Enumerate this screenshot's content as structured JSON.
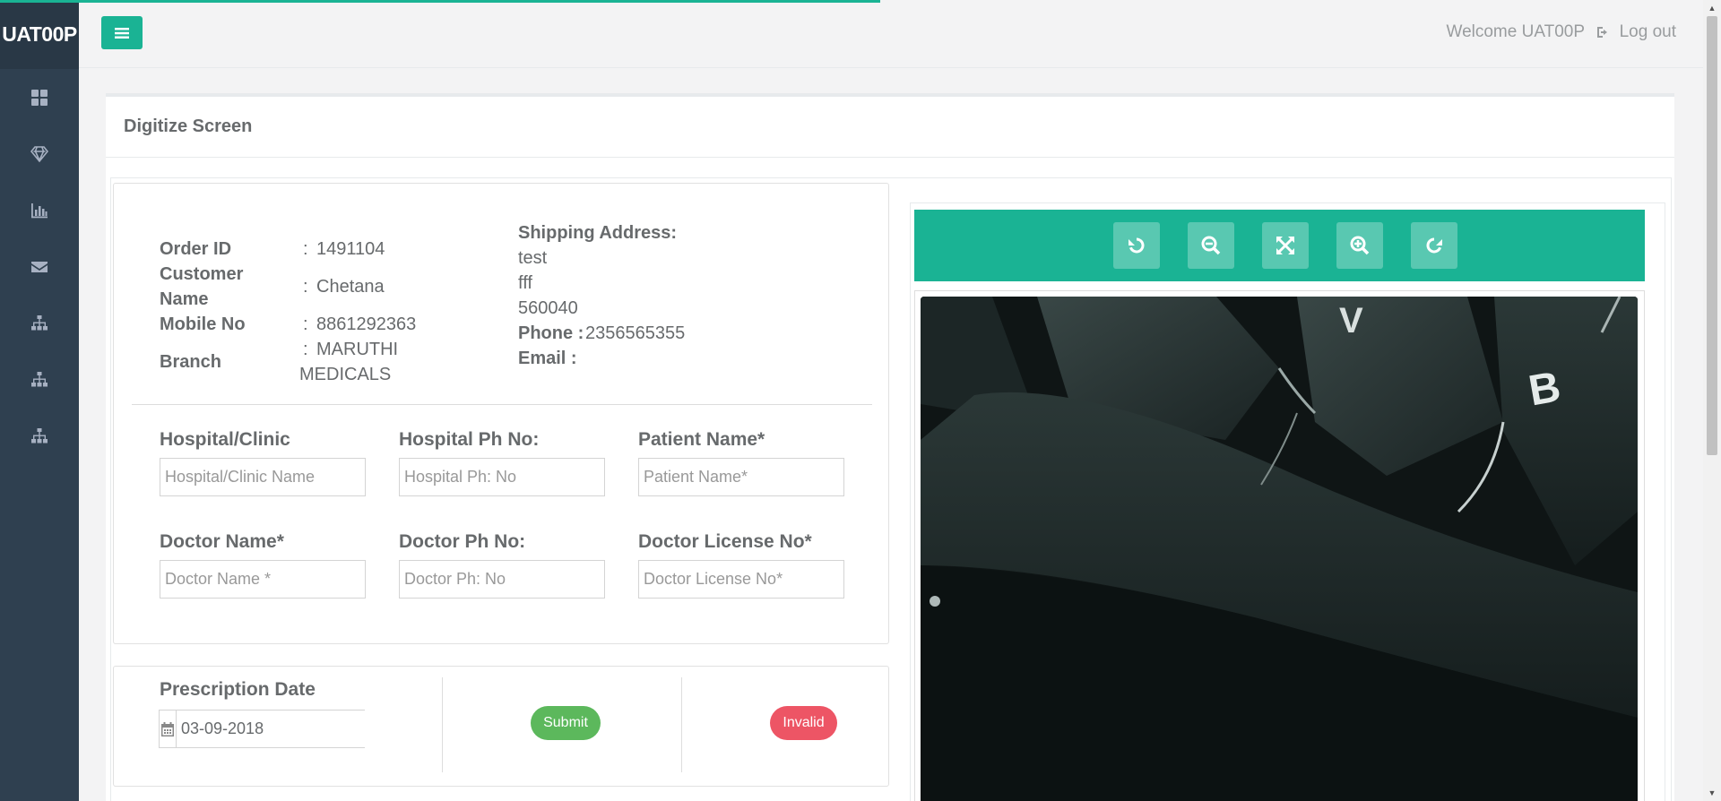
{
  "app": {
    "brand": "UAT00P"
  },
  "header": {
    "welcome_text": "Welcome UAT00P",
    "logout_label": "Log out"
  },
  "sidebar": {
    "items": [
      {
        "icon": "dashboard-icon"
      },
      {
        "icon": "diamond-icon"
      },
      {
        "icon": "bar-chart-icon"
      },
      {
        "icon": "envelope-icon"
      },
      {
        "icon": "sitemap-icon"
      },
      {
        "icon": "sitemap-icon"
      },
      {
        "icon": "sitemap-icon"
      }
    ]
  },
  "page": {
    "title": "Digitize Screen"
  },
  "order": {
    "order_id_label": "Order ID",
    "order_id_value": "1491104",
    "customer_label_1": "Customer",
    "customer_label_2": "Name",
    "customer_value": "Chetana",
    "mobile_label": "Mobile No",
    "mobile_value": "8861292363",
    "branch_label": "Branch",
    "branch_value_1": "MARUTHI",
    "branch_value_2": "MEDICALS",
    "colon": ":",
    "shipping_label": "Shipping Address:",
    "address_lines": [
      "test",
      "fff",
      "560040"
    ],
    "phone_label": "Phone :",
    "phone_value": "2356565355",
    "email_label": "Email :"
  },
  "form": {
    "hospital_label": "Hospital/Clinic",
    "hospital_placeholder": "Hospital/Clinic Name",
    "hospital_ph_label": "Hospital Ph No:",
    "hospital_ph_placeholder": "Hospital Ph: No",
    "patient_label": "Patient Name*",
    "patient_placeholder": "Patient Name*",
    "doctor_label": "Doctor Name*",
    "doctor_placeholder": "Doctor Name *",
    "doctor_ph_label": "Doctor Ph No:",
    "doctor_ph_placeholder": "Doctor Ph: No",
    "license_label": "Doctor License No*",
    "license_placeholder": "Doctor License No*"
  },
  "prescription": {
    "date_label": "Prescription Date",
    "date_value": "03-09-2018",
    "submit_label": "Submit",
    "invalid_label": "Invalid"
  },
  "viewer": {
    "tools": [
      "rotate-left-icon",
      "zoom-out-icon",
      "fullscreen-icon",
      "zoom-in-icon",
      "rotate-right-icon"
    ]
  },
  "colors": {
    "accent": "#1ab394",
    "sidebar": "#2f4050",
    "submit": "#5cb85c",
    "invalid": "#ed5565"
  }
}
